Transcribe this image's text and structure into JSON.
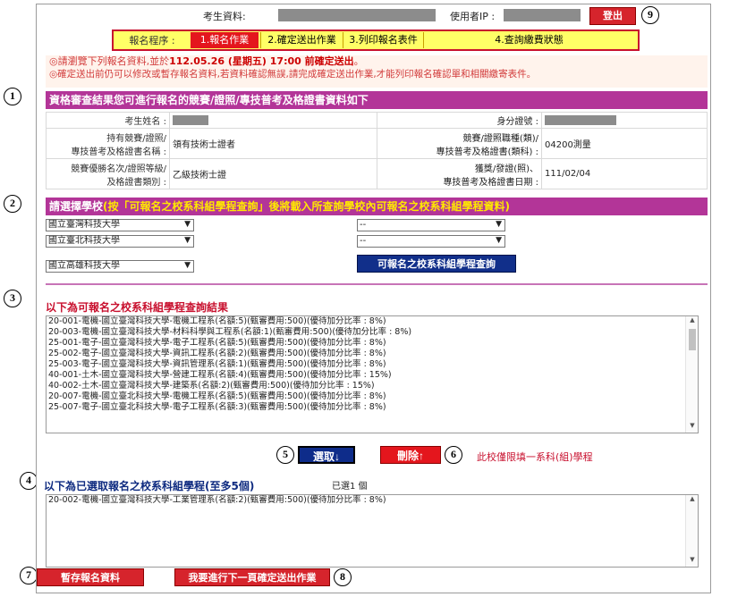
{
  "header": {
    "student_label": "考生資料:",
    "ip_label": "使用者IP :",
    "logout": "登出"
  },
  "steps": {
    "title": "報名程序 :",
    "items": [
      "1.報名作業",
      "2.確定送出作業",
      "3.列印報名表件",
      "4.查詢繳費狀態"
    ]
  },
  "notices": {
    "line1_pre": "◎請瀏覽下列報名資料,並於",
    "line1_date": "112.05.26 (星期五) 17:00 前確定送出",
    "line1_post": "。",
    "line2": "◎確定送出前仍可以修改或暫存報名資料,若資料確認無誤,請完成確定送出作業,才能列印報名確認單和相關繳寄表件。"
  },
  "section1": {
    "title": "資格審查結果您可進行報名的競賽/證照/專技普考及格證書資料如下",
    "name_label": "考生姓名 :",
    "id_label": "身分證號 :",
    "cert_name_label1": "持有競賽/證照/",
    "cert_name_label2": "專技普考及格證書名稱 :",
    "cert_name": "領有技術士證者",
    "cert_type_label1": "競賽/證照職種(類)/",
    "cert_type_label2": "專技普考及格證書(類科) :",
    "cert_type": "04200測量",
    "rank_label1": "競賽優勝名次/證照等級/",
    "rank_label2": "及格證書類別 :",
    "rank": "乙級技術士證",
    "date_label1": "獲獎/發證(照)、",
    "date_label2": "專技普考及格證書日期 :",
    "date": "111/02/04"
  },
  "section2": {
    "title_pre": "請選擇學校",
    "title_post": "(按「可報名之校系科組學程查詢」後將載入所查詢學校內可報名之校系科組學程資料)",
    "schools": [
      "國立臺灣科技大學",
      "國立臺北科技大學",
      "國立高雄科技大學"
    ],
    "blanks": [
      "--",
      "--"
    ],
    "query_btn": "可報名之校系科組學程查詢"
  },
  "section3": {
    "title": "以下為可報名之校系科組學程查詢結果",
    "rows": [
      "20-001-電機-國立臺灣科技大學-電機工程系(名額:5)(甄審費用:500)(優待加分比率 : 8%)",
      "20-003-電機-國立臺灣科技大學-材料科學與工程系(名額:1)(甄審費用:500)(優待加分比率 : 8%)",
      "25-001-電子-國立臺灣科技大學-電子工程系(名額:5)(甄審費用:500)(優待加分比率 : 8%)",
      "25-002-電子-國立臺灣科技大學-資訊工程系(名額:2)(甄審費用:500)(優待加分比率 : 8%)",
      "25-003-電子-國立臺灣科技大學-資訊管理系(名額:1)(甄審費用:500)(優待加分比率 : 8%)",
      "40-001-土木-國立臺灣科技大學-營建工程系(名額:4)(甄審費用:500)(優待加分比率 : 15%)",
      "40-002-土木-國立臺灣科技大學-建築系(名額:2)(甄審費用:500)(優待加分比率 : 15%)",
      "20-007-電機-國立臺北科技大學-電機工程系(名額:5)(甄審費用:500)(優待加分比率 : 8%)",
      "25-007-電子-國立臺北科技大學-電子工程系(名額:3)(甄審費用:500)(優待加分比率 : 8%)"
    ],
    "select_btn": "選取↓",
    "delete_btn": "刪除↑",
    "limit_note": "此校僅限填一系科(組)學程"
  },
  "section4": {
    "title": "以下為已選取報名之校系科組學程(至多5個)",
    "count": "已選1 個",
    "rows": [
      "20-002-電機-國立臺灣科技大學-工業管理系(名額:2)(甄審費用:500)(優待加分比率 : 8%)"
    ]
  },
  "footer": {
    "save_btn": "暫存報名資料",
    "next_btn": "我要進行下一頁確定送出作業"
  },
  "markers": [
    "1",
    "2",
    "3",
    "4",
    "5",
    "6",
    "7",
    "8",
    "9"
  ]
}
